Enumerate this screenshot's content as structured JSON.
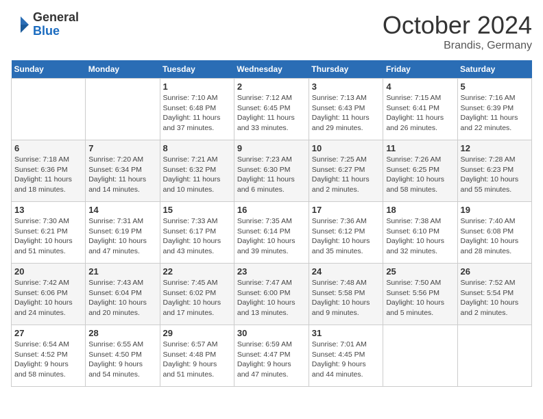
{
  "header": {
    "logo_general": "General",
    "logo_blue": "Blue",
    "month": "October 2024",
    "location": "Brandis, Germany"
  },
  "weekdays": [
    "Sunday",
    "Monday",
    "Tuesday",
    "Wednesday",
    "Thursday",
    "Friday",
    "Saturday"
  ],
  "weeks": [
    [
      {
        "day": "",
        "info": ""
      },
      {
        "day": "",
        "info": ""
      },
      {
        "day": "1",
        "info": "Sunrise: 7:10 AM\nSunset: 6:48 PM\nDaylight: 11 hours\nand 37 minutes."
      },
      {
        "day": "2",
        "info": "Sunrise: 7:12 AM\nSunset: 6:45 PM\nDaylight: 11 hours\nand 33 minutes."
      },
      {
        "day": "3",
        "info": "Sunrise: 7:13 AM\nSunset: 6:43 PM\nDaylight: 11 hours\nand 29 minutes."
      },
      {
        "day": "4",
        "info": "Sunrise: 7:15 AM\nSunset: 6:41 PM\nDaylight: 11 hours\nand 26 minutes."
      },
      {
        "day": "5",
        "info": "Sunrise: 7:16 AM\nSunset: 6:39 PM\nDaylight: 11 hours\nand 22 minutes."
      }
    ],
    [
      {
        "day": "6",
        "info": "Sunrise: 7:18 AM\nSunset: 6:36 PM\nDaylight: 11 hours\nand 18 minutes."
      },
      {
        "day": "7",
        "info": "Sunrise: 7:20 AM\nSunset: 6:34 PM\nDaylight: 11 hours\nand 14 minutes."
      },
      {
        "day": "8",
        "info": "Sunrise: 7:21 AM\nSunset: 6:32 PM\nDaylight: 11 hours\nand 10 minutes."
      },
      {
        "day": "9",
        "info": "Sunrise: 7:23 AM\nSunset: 6:30 PM\nDaylight: 11 hours\nand 6 minutes."
      },
      {
        "day": "10",
        "info": "Sunrise: 7:25 AM\nSunset: 6:27 PM\nDaylight: 11 hours\nand 2 minutes."
      },
      {
        "day": "11",
        "info": "Sunrise: 7:26 AM\nSunset: 6:25 PM\nDaylight: 10 hours\nand 58 minutes."
      },
      {
        "day": "12",
        "info": "Sunrise: 7:28 AM\nSunset: 6:23 PM\nDaylight: 10 hours\nand 55 minutes."
      }
    ],
    [
      {
        "day": "13",
        "info": "Sunrise: 7:30 AM\nSunset: 6:21 PM\nDaylight: 10 hours\nand 51 minutes."
      },
      {
        "day": "14",
        "info": "Sunrise: 7:31 AM\nSunset: 6:19 PM\nDaylight: 10 hours\nand 47 minutes."
      },
      {
        "day": "15",
        "info": "Sunrise: 7:33 AM\nSunset: 6:17 PM\nDaylight: 10 hours\nand 43 minutes."
      },
      {
        "day": "16",
        "info": "Sunrise: 7:35 AM\nSunset: 6:14 PM\nDaylight: 10 hours\nand 39 minutes."
      },
      {
        "day": "17",
        "info": "Sunrise: 7:36 AM\nSunset: 6:12 PM\nDaylight: 10 hours\nand 35 minutes."
      },
      {
        "day": "18",
        "info": "Sunrise: 7:38 AM\nSunset: 6:10 PM\nDaylight: 10 hours\nand 32 minutes."
      },
      {
        "day": "19",
        "info": "Sunrise: 7:40 AM\nSunset: 6:08 PM\nDaylight: 10 hours\nand 28 minutes."
      }
    ],
    [
      {
        "day": "20",
        "info": "Sunrise: 7:42 AM\nSunset: 6:06 PM\nDaylight: 10 hours\nand 24 minutes."
      },
      {
        "day": "21",
        "info": "Sunrise: 7:43 AM\nSunset: 6:04 PM\nDaylight: 10 hours\nand 20 minutes."
      },
      {
        "day": "22",
        "info": "Sunrise: 7:45 AM\nSunset: 6:02 PM\nDaylight: 10 hours\nand 17 minutes."
      },
      {
        "day": "23",
        "info": "Sunrise: 7:47 AM\nSunset: 6:00 PM\nDaylight: 10 hours\nand 13 minutes."
      },
      {
        "day": "24",
        "info": "Sunrise: 7:48 AM\nSunset: 5:58 PM\nDaylight: 10 hours\nand 9 minutes."
      },
      {
        "day": "25",
        "info": "Sunrise: 7:50 AM\nSunset: 5:56 PM\nDaylight: 10 hours\nand 5 minutes."
      },
      {
        "day": "26",
        "info": "Sunrise: 7:52 AM\nSunset: 5:54 PM\nDaylight: 10 hours\nand 2 minutes."
      }
    ],
    [
      {
        "day": "27",
        "info": "Sunrise: 6:54 AM\nSunset: 4:52 PM\nDaylight: 9 hours\nand 58 minutes."
      },
      {
        "day": "28",
        "info": "Sunrise: 6:55 AM\nSunset: 4:50 PM\nDaylight: 9 hours\nand 54 minutes."
      },
      {
        "day": "29",
        "info": "Sunrise: 6:57 AM\nSunset: 4:48 PM\nDaylight: 9 hours\nand 51 minutes."
      },
      {
        "day": "30",
        "info": "Sunrise: 6:59 AM\nSunset: 4:47 PM\nDaylight: 9 hours\nand 47 minutes."
      },
      {
        "day": "31",
        "info": "Sunrise: 7:01 AM\nSunset: 4:45 PM\nDaylight: 9 hours\nand 44 minutes."
      },
      {
        "day": "",
        "info": ""
      },
      {
        "day": "",
        "info": ""
      }
    ]
  ]
}
